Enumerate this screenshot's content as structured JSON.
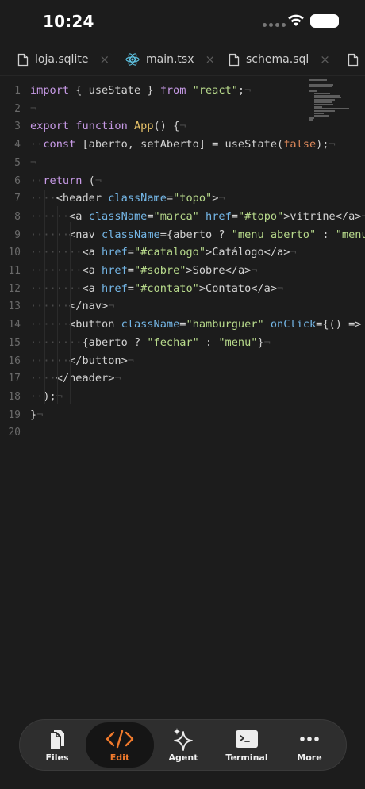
{
  "status": {
    "time": "10:24"
  },
  "tabs": [
    {
      "label": "loja.sqlite",
      "icon": "file-icon",
      "close": "×"
    },
    {
      "label": "main.tsx",
      "icon": "react-icon",
      "close": "×"
    },
    {
      "label": "schema.sql",
      "icon": "file-icon",
      "close": "×"
    },
    {
      "label": "",
      "icon": "file-icon",
      "close": ""
    }
  ],
  "editor": {
    "line_numbers": [
      "1",
      "2",
      "3",
      "4",
      "5",
      "6",
      "7",
      "8",
      "9",
      "10",
      "11",
      "12",
      "13",
      "14",
      "15",
      "16",
      "17",
      "18",
      "19",
      "20"
    ],
    "lines": [
      "import { useState } from \"react\";",
      "",
      "export function App() {",
      "  const [aberto, setAberto] = useState(false);",
      "",
      "  return (",
      "    <header className=\"topo\">",
      "      <a className=\"marca\" href=\"#topo\">vitrine</a>",
      "      <nav className={aberto ? \"menu aberto\" : \"menu\"}>",
      "        <a href=\"#catalogo\">Catálogo</a>",
      "        <a href=\"#sobre\">Sobre</a>",
      "        <a href=\"#contato\">Contato</a>",
      "      </nav>",
      "      <button className=\"hamburguer\" onClick={() => setAberto(!aberto)}>",
      "        {aberto ? \"fechar\" : \"menu\"}",
      "      </button>",
      "    </header>",
      "  );",
      "}",
      ""
    ],
    "eol_marker": "¬"
  },
  "toolbar": {
    "items": [
      {
        "label": "Files",
        "icon": "files-icon"
      },
      {
        "label": "Edit",
        "icon": "code-icon",
        "active": true
      },
      {
        "label": "Agent",
        "icon": "sparkle-icon"
      },
      {
        "label": "Terminal",
        "icon": "terminal-icon"
      },
      {
        "label": "More",
        "icon": "more-icon"
      }
    ]
  },
  "colors": {
    "background": "#1c1c1c",
    "keyword": "#c79ae6",
    "function": "#e9c46a",
    "string": "#b7d98b",
    "attribute": "#74b6e6",
    "accent": "#f07a2c"
  }
}
